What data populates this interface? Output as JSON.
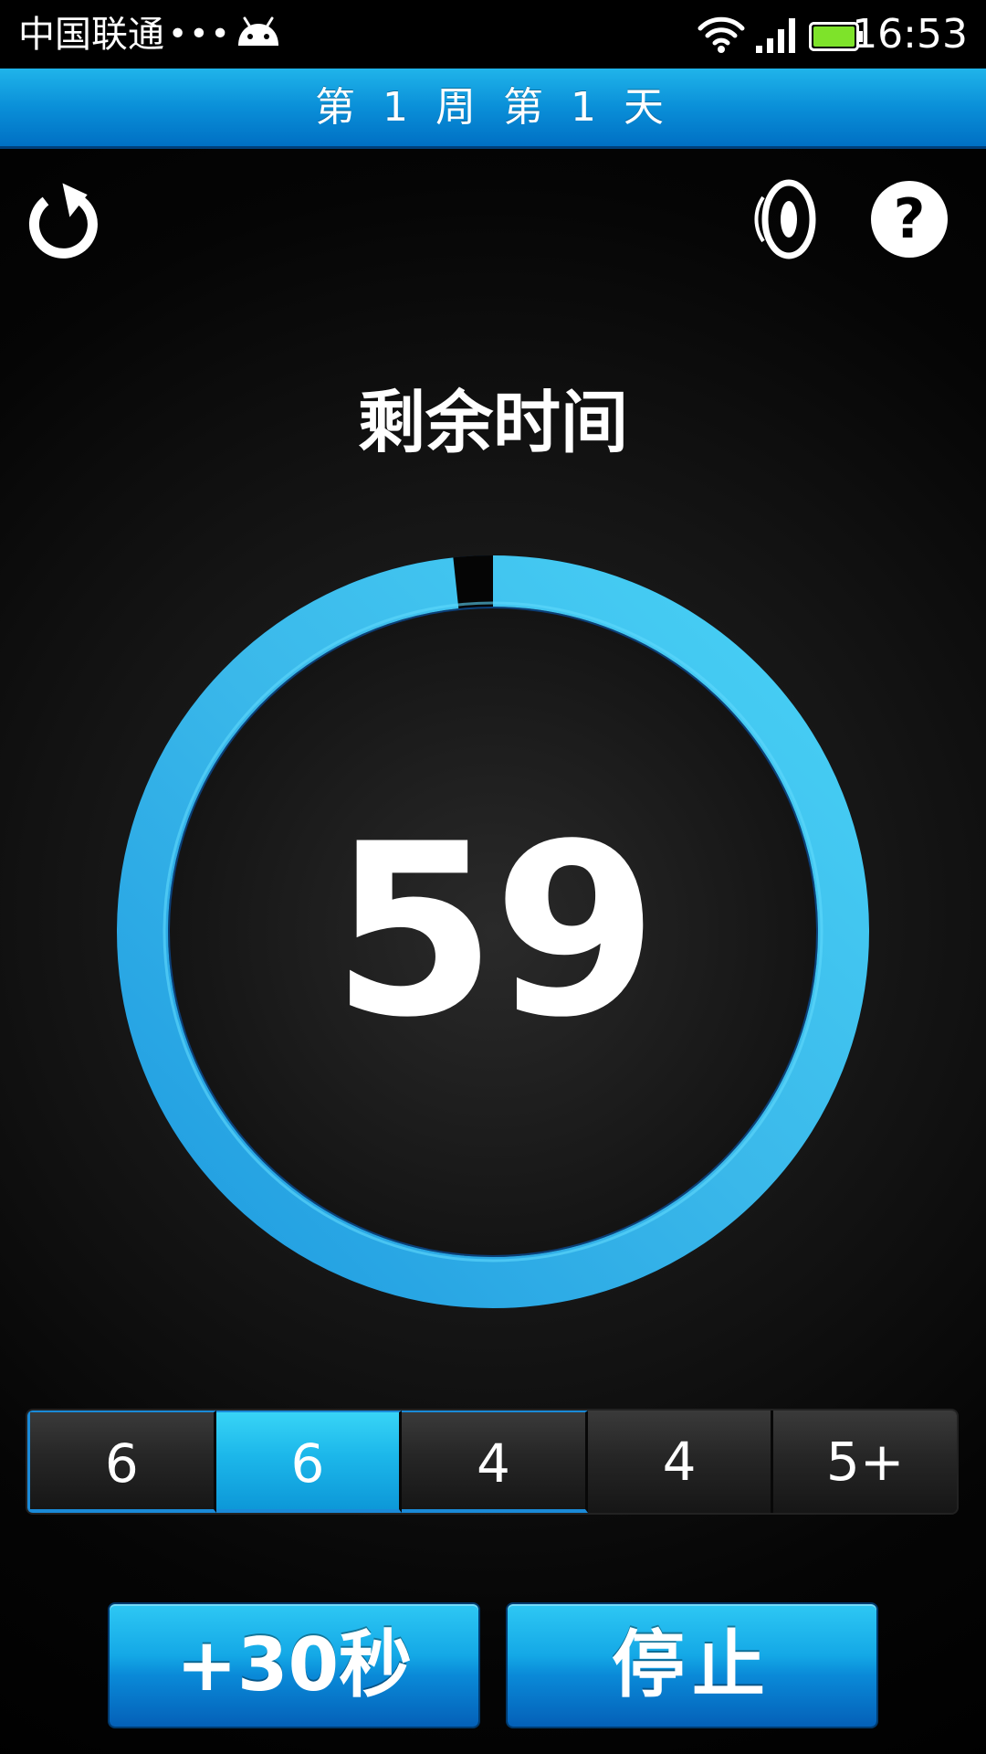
{
  "status_bar": {
    "carrier": "中国联通",
    "dots": "•••",
    "time": "16:53"
  },
  "header": {
    "title": "第 1 周 第 1 天"
  },
  "icons": {
    "reset": "reset-icon",
    "sound": "sound-icon",
    "help": "help-icon",
    "android": "android-icon",
    "wifi": "wifi-icon",
    "signal": "signal-icon",
    "battery": "battery-icon"
  },
  "timer": {
    "label": "剩余时间",
    "value": "59",
    "progress_fraction": 0.983
  },
  "segments": [
    {
      "label": "6",
      "state": "done"
    },
    {
      "label": "6",
      "state": "active"
    },
    {
      "label": "4",
      "state": "done"
    },
    {
      "label": "4",
      "state": "pending"
    },
    {
      "label": "5+",
      "state": "pending"
    }
  ],
  "buttons": {
    "add_label": "+30秒",
    "stop_label": "停止"
  },
  "colors": {
    "accent": "#14a8e6",
    "accent_dark": "#0460b8",
    "ring": "#3ab8ea",
    "battery": "#7ee32a"
  }
}
